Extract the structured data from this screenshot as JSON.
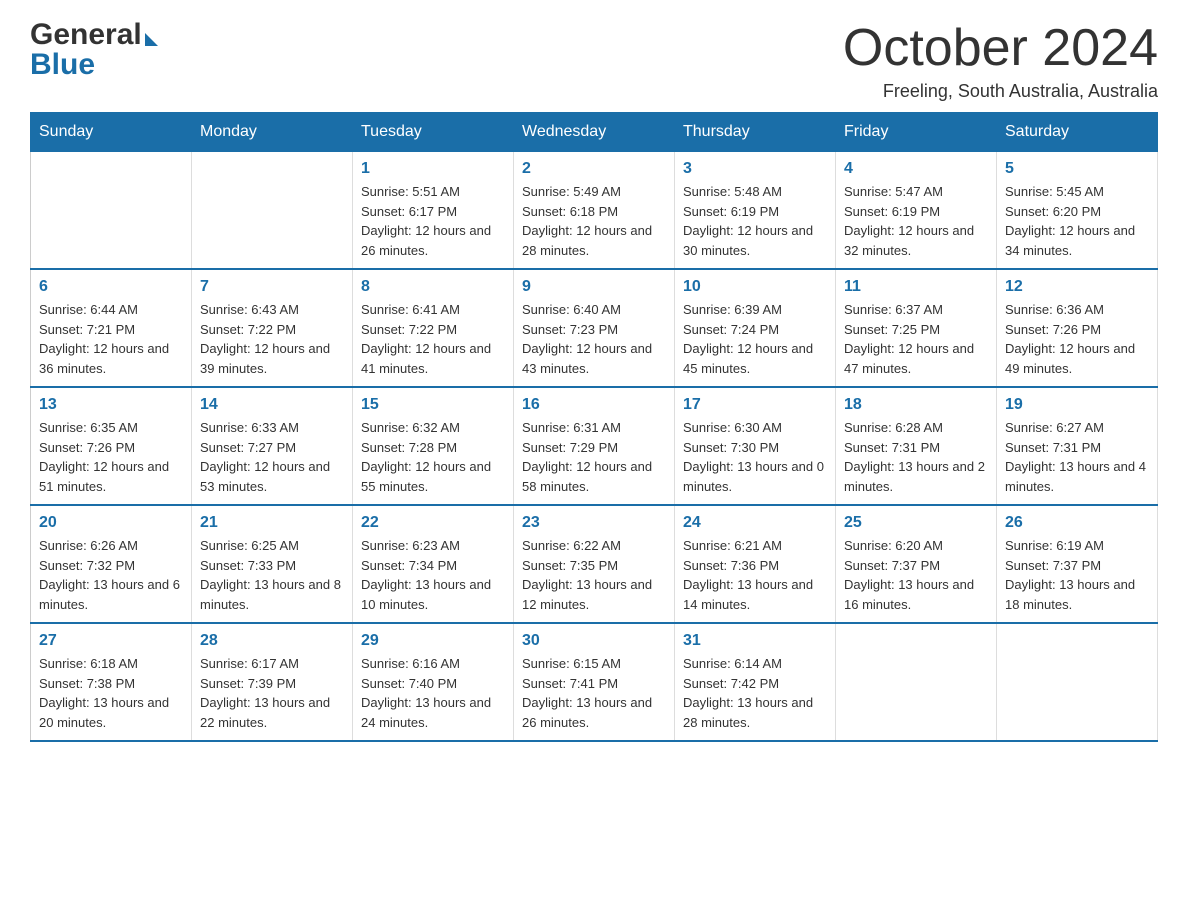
{
  "header": {
    "title": "October 2024",
    "location": "Freeling, South Australia, Australia"
  },
  "logo": {
    "general": "General",
    "blue": "Blue"
  },
  "weekdays": [
    "Sunday",
    "Monday",
    "Tuesday",
    "Wednesday",
    "Thursday",
    "Friday",
    "Saturday"
  ],
  "weeks": [
    [
      {
        "day": "",
        "sunrise": "",
        "sunset": "",
        "daylight": ""
      },
      {
        "day": "",
        "sunrise": "",
        "sunset": "",
        "daylight": ""
      },
      {
        "day": "1",
        "sunrise": "Sunrise: 5:51 AM",
        "sunset": "Sunset: 6:17 PM",
        "daylight": "Daylight: 12 hours and 26 minutes."
      },
      {
        "day": "2",
        "sunrise": "Sunrise: 5:49 AM",
        "sunset": "Sunset: 6:18 PM",
        "daylight": "Daylight: 12 hours and 28 minutes."
      },
      {
        "day": "3",
        "sunrise": "Sunrise: 5:48 AM",
        "sunset": "Sunset: 6:19 PM",
        "daylight": "Daylight: 12 hours and 30 minutes."
      },
      {
        "day": "4",
        "sunrise": "Sunrise: 5:47 AM",
        "sunset": "Sunset: 6:19 PM",
        "daylight": "Daylight: 12 hours and 32 minutes."
      },
      {
        "day": "5",
        "sunrise": "Sunrise: 5:45 AM",
        "sunset": "Sunset: 6:20 PM",
        "daylight": "Daylight: 12 hours and 34 minutes."
      }
    ],
    [
      {
        "day": "6",
        "sunrise": "Sunrise: 6:44 AM",
        "sunset": "Sunset: 7:21 PM",
        "daylight": "Daylight: 12 hours and 36 minutes."
      },
      {
        "day": "7",
        "sunrise": "Sunrise: 6:43 AM",
        "sunset": "Sunset: 7:22 PM",
        "daylight": "Daylight: 12 hours and 39 minutes."
      },
      {
        "day": "8",
        "sunrise": "Sunrise: 6:41 AM",
        "sunset": "Sunset: 7:22 PM",
        "daylight": "Daylight: 12 hours and 41 minutes."
      },
      {
        "day": "9",
        "sunrise": "Sunrise: 6:40 AM",
        "sunset": "Sunset: 7:23 PM",
        "daylight": "Daylight: 12 hours and 43 minutes."
      },
      {
        "day": "10",
        "sunrise": "Sunrise: 6:39 AM",
        "sunset": "Sunset: 7:24 PM",
        "daylight": "Daylight: 12 hours and 45 minutes."
      },
      {
        "day": "11",
        "sunrise": "Sunrise: 6:37 AM",
        "sunset": "Sunset: 7:25 PM",
        "daylight": "Daylight: 12 hours and 47 minutes."
      },
      {
        "day": "12",
        "sunrise": "Sunrise: 6:36 AM",
        "sunset": "Sunset: 7:26 PM",
        "daylight": "Daylight: 12 hours and 49 minutes."
      }
    ],
    [
      {
        "day": "13",
        "sunrise": "Sunrise: 6:35 AM",
        "sunset": "Sunset: 7:26 PM",
        "daylight": "Daylight: 12 hours and 51 minutes."
      },
      {
        "day": "14",
        "sunrise": "Sunrise: 6:33 AM",
        "sunset": "Sunset: 7:27 PM",
        "daylight": "Daylight: 12 hours and 53 minutes."
      },
      {
        "day": "15",
        "sunrise": "Sunrise: 6:32 AM",
        "sunset": "Sunset: 7:28 PM",
        "daylight": "Daylight: 12 hours and 55 minutes."
      },
      {
        "day": "16",
        "sunrise": "Sunrise: 6:31 AM",
        "sunset": "Sunset: 7:29 PM",
        "daylight": "Daylight: 12 hours and 58 minutes."
      },
      {
        "day": "17",
        "sunrise": "Sunrise: 6:30 AM",
        "sunset": "Sunset: 7:30 PM",
        "daylight": "Daylight: 13 hours and 0 minutes."
      },
      {
        "day": "18",
        "sunrise": "Sunrise: 6:28 AM",
        "sunset": "Sunset: 7:31 PM",
        "daylight": "Daylight: 13 hours and 2 minutes."
      },
      {
        "day": "19",
        "sunrise": "Sunrise: 6:27 AM",
        "sunset": "Sunset: 7:31 PM",
        "daylight": "Daylight: 13 hours and 4 minutes."
      }
    ],
    [
      {
        "day": "20",
        "sunrise": "Sunrise: 6:26 AM",
        "sunset": "Sunset: 7:32 PM",
        "daylight": "Daylight: 13 hours and 6 minutes."
      },
      {
        "day": "21",
        "sunrise": "Sunrise: 6:25 AM",
        "sunset": "Sunset: 7:33 PM",
        "daylight": "Daylight: 13 hours and 8 minutes."
      },
      {
        "day": "22",
        "sunrise": "Sunrise: 6:23 AM",
        "sunset": "Sunset: 7:34 PM",
        "daylight": "Daylight: 13 hours and 10 minutes."
      },
      {
        "day": "23",
        "sunrise": "Sunrise: 6:22 AM",
        "sunset": "Sunset: 7:35 PM",
        "daylight": "Daylight: 13 hours and 12 minutes."
      },
      {
        "day": "24",
        "sunrise": "Sunrise: 6:21 AM",
        "sunset": "Sunset: 7:36 PM",
        "daylight": "Daylight: 13 hours and 14 minutes."
      },
      {
        "day": "25",
        "sunrise": "Sunrise: 6:20 AM",
        "sunset": "Sunset: 7:37 PM",
        "daylight": "Daylight: 13 hours and 16 minutes."
      },
      {
        "day": "26",
        "sunrise": "Sunrise: 6:19 AM",
        "sunset": "Sunset: 7:37 PM",
        "daylight": "Daylight: 13 hours and 18 minutes."
      }
    ],
    [
      {
        "day": "27",
        "sunrise": "Sunrise: 6:18 AM",
        "sunset": "Sunset: 7:38 PM",
        "daylight": "Daylight: 13 hours and 20 minutes."
      },
      {
        "day": "28",
        "sunrise": "Sunrise: 6:17 AM",
        "sunset": "Sunset: 7:39 PM",
        "daylight": "Daylight: 13 hours and 22 minutes."
      },
      {
        "day": "29",
        "sunrise": "Sunrise: 6:16 AM",
        "sunset": "Sunset: 7:40 PM",
        "daylight": "Daylight: 13 hours and 24 minutes."
      },
      {
        "day": "30",
        "sunrise": "Sunrise: 6:15 AM",
        "sunset": "Sunset: 7:41 PM",
        "daylight": "Daylight: 13 hours and 26 minutes."
      },
      {
        "day": "31",
        "sunrise": "Sunrise: 6:14 AM",
        "sunset": "Sunset: 7:42 PM",
        "daylight": "Daylight: 13 hours and 28 minutes."
      },
      {
        "day": "",
        "sunrise": "",
        "sunset": "",
        "daylight": ""
      },
      {
        "day": "",
        "sunrise": "",
        "sunset": "",
        "daylight": ""
      }
    ]
  ]
}
